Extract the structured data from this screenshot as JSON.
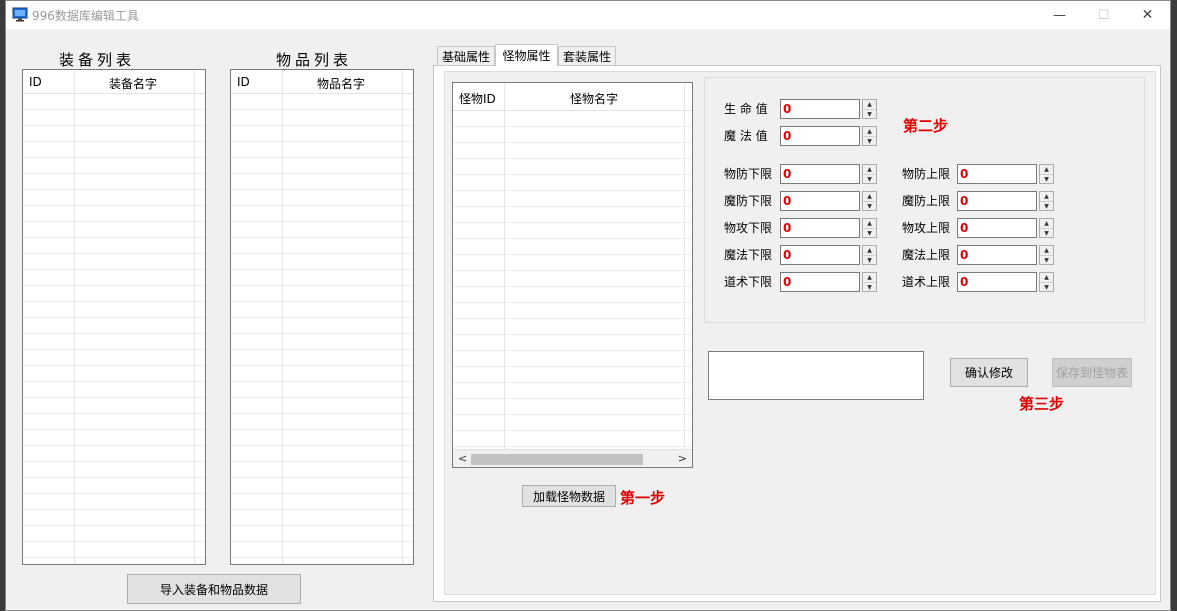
{
  "window": {
    "title": "996数据库编辑工具",
    "min_glyph": "—",
    "max_glyph": "☐",
    "close_glyph": "✕"
  },
  "equip_list": {
    "title": "装备列表",
    "col_id": "ID",
    "col_name": "装备名字"
  },
  "item_list": {
    "title": "物品列表",
    "col_id": "ID",
    "col_name": "物品名字"
  },
  "import_button": "导入装备和物品数据",
  "tabs": [
    {
      "label": "基础属性",
      "active": false
    },
    {
      "label": "怪物属性",
      "active": true
    },
    {
      "label": "套装属性",
      "active": false
    }
  ],
  "monster_list": {
    "col_id": "怪物ID",
    "col_name": "怪物名字",
    "scroll_left": "<",
    "scroll_right": ">"
  },
  "load_button": "加载怪物数据",
  "steps": {
    "one": "第一步",
    "two": "第二步",
    "three": "第三步"
  },
  "attrs": {
    "hp": {
      "label": "生 命 值",
      "value": "0"
    },
    "mp": {
      "label": "魔 法 值",
      "value": "0"
    },
    "def_min": {
      "label": "物防下限",
      "value": "0"
    },
    "def_max": {
      "label": "物防上限",
      "value": "0"
    },
    "mdef_min": {
      "label": "魔防下限",
      "value": "0"
    },
    "mdef_max": {
      "label": "魔防上限",
      "value": "0"
    },
    "atk_min": {
      "label": "物攻下限",
      "value": "0"
    },
    "atk_max": {
      "label": "物攻上限",
      "value": "0"
    },
    "mag_min": {
      "label": "魔法下限",
      "value": "0"
    },
    "mag_max": {
      "label": "魔法上限",
      "value": "0"
    },
    "tao_min": {
      "label": "道术下限",
      "value": "0"
    },
    "tao_max": {
      "label": "道术上限",
      "value": "0"
    }
  },
  "confirm_button": "确认修改",
  "save_button": "保存到怪物表",
  "colors": {
    "accent_red": "#e00000",
    "window_bg": "#f0f0f0"
  },
  "icons": {
    "app": "app-monitor-icon",
    "spin_up": "▲",
    "spin_down": "▼"
  }
}
